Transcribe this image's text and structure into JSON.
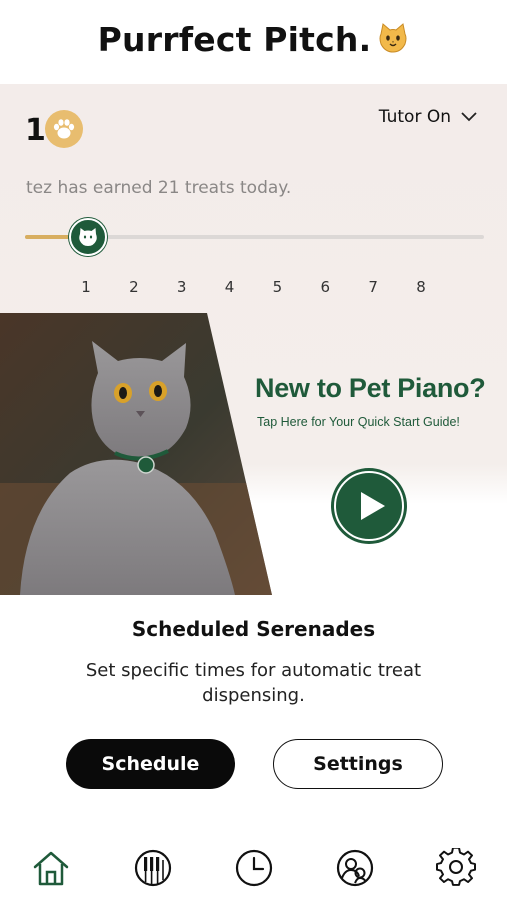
{
  "header": {
    "title": "Purrfect Pitch.",
    "title_icon": "cat-face-icon"
  },
  "progress": {
    "level": "1",
    "level_icon": "paw-icon",
    "tutor_label": "Tutor On",
    "status": "tez has earned 21 treats today.",
    "slider": {
      "min": 1,
      "max": 8,
      "value": 1,
      "ticks": [
        "1",
        "2",
        "3",
        "4",
        "5",
        "6",
        "7",
        "8"
      ]
    }
  },
  "promo": {
    "title": "New to Pet Piano?",
    "subtitle": "Tap Here for Your Quick Start Guide!",
    "play_icon": "play-icon",
    "image": "cat-photo"
  },
  "schedule": {
    "title": "Scheduled Serenades",
    "description": "Set specific times for automatic treat dispensing.",
    "primary_button": "Schedule",
    "secondary_button": "Settings"
  },
  "nav": {
    "items": [
      {
        "icon": "home-icon",
        "active": true
      },
      {
        "icon": "piano-icon",
        "active": false
      },
      {
        "icon": "clock-icon",
        "active": false
      },
      {
        "icon": "pets-profile-icon",
        "active": false
      },
      {
        "icon": "gear-icon",
        "active": false
      }
    ]
  },
  "colors": {
    "accent_green": "#1f5a3a",
    "gold": "#d8ae60",
    "panel_bg": "#f3ecea",
    "button_dark": "#0a0a0a"
  }
}
